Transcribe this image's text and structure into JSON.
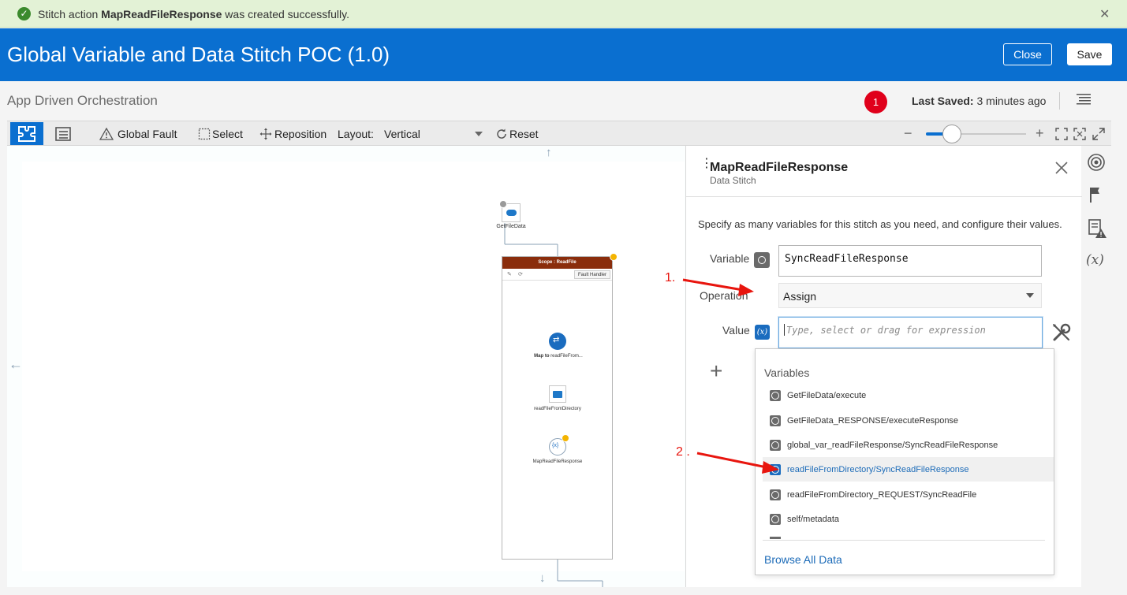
{
  "banner": {
    "prefix": "Stitch action ",
    "action_name": "MapReadFileResponse",
    "suffix": " was created successfully.",
    "close": "✕"
  },
  "header": {
    "title": "Global Variable and Data Stitch POC (1.0)",
    "close_label": "Close",
    "save_label": "Save"
  },
  "subheader": {
    "label": "App Driven Orchestration",
    "badge_count": "1",
    "last_saved_label": "Last Saved:",
    "last_saved_value": " 3 minutes ago"
  },
  "toolbar": {
    "global_fault": "Global Fault",
    "select": "Select",
    "reposition": "Reposition",
    "layout_label": "Layout:",
    "layout_value": "Vertical",
    "reset": "Reset",
    "zoom_level": 0.2
  },
  "canvas": {
    "nodes": {
      "get_file_data": "GetFileData",
      "scope_title": "Scope : ReadFile",
      "fault_handler": "Fault Handler",
      "map_label_bold": "Map to",
      "map_label_rest": " readFileFrom...",
      "read_file": "readFileFromDirectory",
      "map_read": "MapReadFileResponse"
    }
  },
  "panel": {
    "title": "MapReadFileResponse",
    "subtitle": "Data Stitch",
    "description": "Specify as many variables for this stitch as you need, and configure their values.",
    "variable_label": "Variable",
    "variable_value": "SyncReadFileResponse",
    "operation_label": "Operation",
    "operation_value": "Assign",
    "value_label": "Value",
    "value_placeholder": "Type, select or drag for expression",
    "add": "+"
  },
  "dropdown": {
    "header": "Variables",
    "items": [
      "GetFileData/execute",
      "GetFileData_RESPONSE/executeResponse",
      "global_var_readFileResponse/SyncReadFileResponse",
      "readFileFromDirectory/SyncReadFileResponse",
      "readFileFromDirectory_REQUEST/SyncReadFile",
      "self/metadata"
    ],
    "highlighted_index": 3,
    "browse": "Browse All Data"
  },
  "annotations": {
    "one": "1.",
    "two": "2 ."
  },
  "colors": {
    "brand_blue": "#0a6fd0",
    "success_bg": "#e3f2d6",
    "annotation_red": "#e8150e",
    "scope_header": "#8a2d0c"
  }
}
